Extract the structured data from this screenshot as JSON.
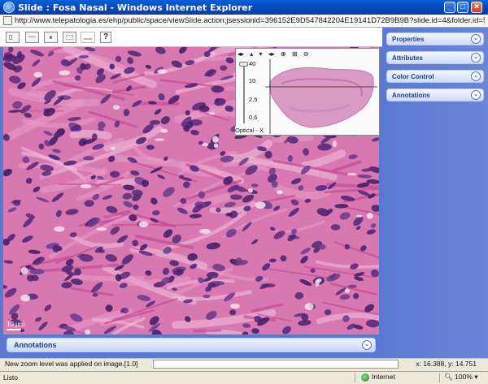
{
  "window": {
    "title": "Slide : Fosa Nasal - Windows Internet Explorer",
    "minimize": "_",
    "maximize": "□",
    "close": "×"
  },
  "address": {
    "url": "http://www.telepatologia.es/ehp/public/space/viewSlide.action;jsessionid=396152E9D547842204E19141D72B9B9B?slide.id=4&folder.id=5&readonly=true"
  },
  "toolbar": {
    "buttons": [
      "select-tool",
      "measure-tool",
      "region-tool",
      "annotation-tool",
      "ruler-tool"
    ],
    "help_label": "?"
  },
  "overview": {
    "nav_icons": [
      "◂▸",
      "▴",
      "▾",
      "◂▸",
      "zoom-in",
      "zoom-fit",
      "zoom-out"
    ],
    "zoom_levels": [
      "40",
      "10",
      "2,5",
      "0,6"
    ],
    "label": "Optical - X"
  },
  "scalebar": {
    "label": "10 µm"
  },
  "annotations_bar": {
    "label": "Annotations"
  },
  "right_panel": {
    "items": [
      {
        "label": "Properties"
      },
      {
        "label": "Attributes"
      },
      {
        "label": "Color Control"
      },
      {
        "label": "Annotations"
      }
    ]
  },
  "app_status": {
    "message": "New zoom level was applied on image.[1.0]",
    "coords": "x: 16.388, y: 14.751"
  },
  "ie_status": {
    "text": "Listo",
    "zone": "Internet",
    "zoom": "100%"
  },
  "colors": {
    "title_bar": "#0646b8",
    "panel_bg": "#5a78d0",
    "tissue_pink": "#d56fa8",
    "nucleus_purple": "#5b2a7a"
  }
}
